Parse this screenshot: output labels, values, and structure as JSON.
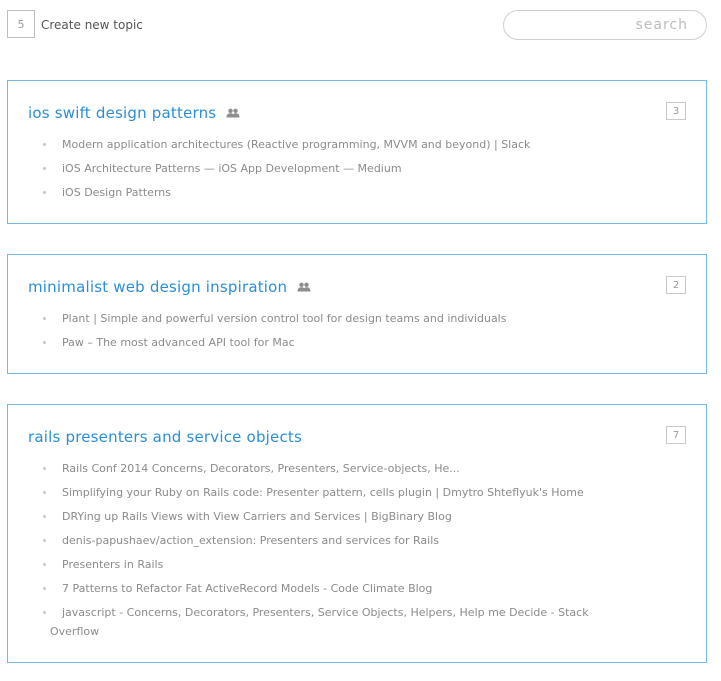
{
  "toolbar": {
    "topic_count": "5",
    "create_label": "Create new topic",
    "search_placeholder": "search"
  },
  "topics": [
    {
      "title": "ios swift design patterns",
      "shared_icon": "group-icon",
      "count": "3",
      "links": [
        "Modern application architectures (Reactive programming, MVVM and beyond) | Slack",
        "iOS Architecture Patterns — iOS App Development — Medium",
        "iOS Design Patterns"
      ]
    },
    {
      "title": "minimalist web design inspiration",
      "shared_icon": "group-icon",
      "count": "2",
      "links": [
        "Plant | Simple and powerful version control tool for design teams and individuals",
        "Paw – The most advanced API tool for Mac"
      ]
    },
    {
      "title": "rails presenters and service objects",
      "count": "7",
      "links": [
        "Rails Conf 2014 Concerns, Decorators, Presenters, Service-objects, He...",
        "Simplifying your Ruby on Rails code: Presenter pattern, cells plugin | Dmytro Shteflyuk's Home",
        "DRYing up Rails Views with View Carriers and Services | BigBinary Blog",
        "denis-papushaev/action_extension: Presenters and services for Rails",
        "Presenters in Rails",
        "7 Patterns to Refactor Fat ActiveRecord Models - Code Climate Blog",
        "javascript - Concerns, Decorators, Presenters, Service Objects, Helpers, Help me Decide - Stack",
        "Overflow"
      ]
    }
  ],
  "colors": {
    "accent": "#2a8fd6",
    "border": "#74b9e3",
    "muted_text": "#8b8b8b"
  }
}
